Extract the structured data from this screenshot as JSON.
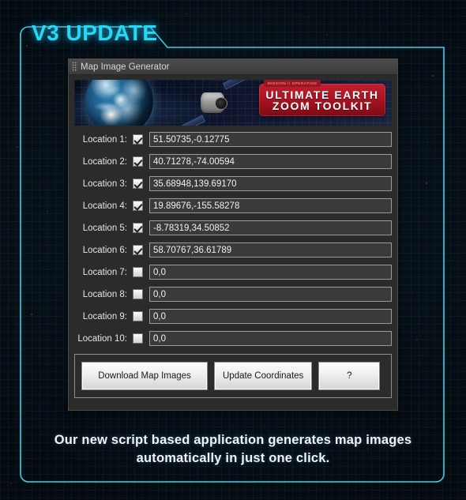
{
  "page": {
    "title": "V3 UPDATE",
    "caption_line1": "Our new script based application generates map images",
    "caption_line2": "automatically in just one click.",
    "accent_color": "#25d8f5",
    "background_color": "#071119"
  },
  "window": {
    "titlebar_text": "Map Image Generator",
    "grip_icon": "drag-grip-icon"
  },
  "banner": {
    "badge_tag": "MISSION \\\\ OPERATION",
    "badge_line1": "ULTIMATE EARTH",
    "badge_line2": "ZOOM TOOLKIT",
    "badge_color": "#b3161f",
    "earth_icon": "earth-globe-image",
    "satellite_icon": "satellite-image"
  },
  "locations": [
    {
      "label": "Location 1:",
      "checked": true,
      "value": "51.50735,-0.12775"
    },
    {
      "label": "Location 2:",
      "checked": true,
      "value": "40.71278,-74.00594"
    },
    {
      "label": "Location 3:",
      "checked": true,
      "value": "35.68948,139.69170"
    },
    {
      "label": "Location 4:",
      "checked": true,
      "value": "19.89676,-155.58278"
    },
    {
      "label": "Location 5:",
      "checked": true,
      "value": "-8.78319,34.50852"
    },
    {
      "label": "Location 6:",
      "checked": true,
      "value": "58.70767,36.61789"
    },
    {
      "label": "Location 7:",
      "checked": false,
      "value": "0,0"
    },
    {
      "label": "Location 8:",
      "checked": false,
      "value": "0,0"
    },
    {
      "label": "Location 9:",
      "checked": false,
      "value": "0,0"
    },
    {
      "label": "Location 10:",
      "checked": false,
      "value": "0,0"
    }
  ],
  "buttons": {
    "download": "Download Map Images",
    "update": "Update Coordinates",
    "help": "?"
  }
}
